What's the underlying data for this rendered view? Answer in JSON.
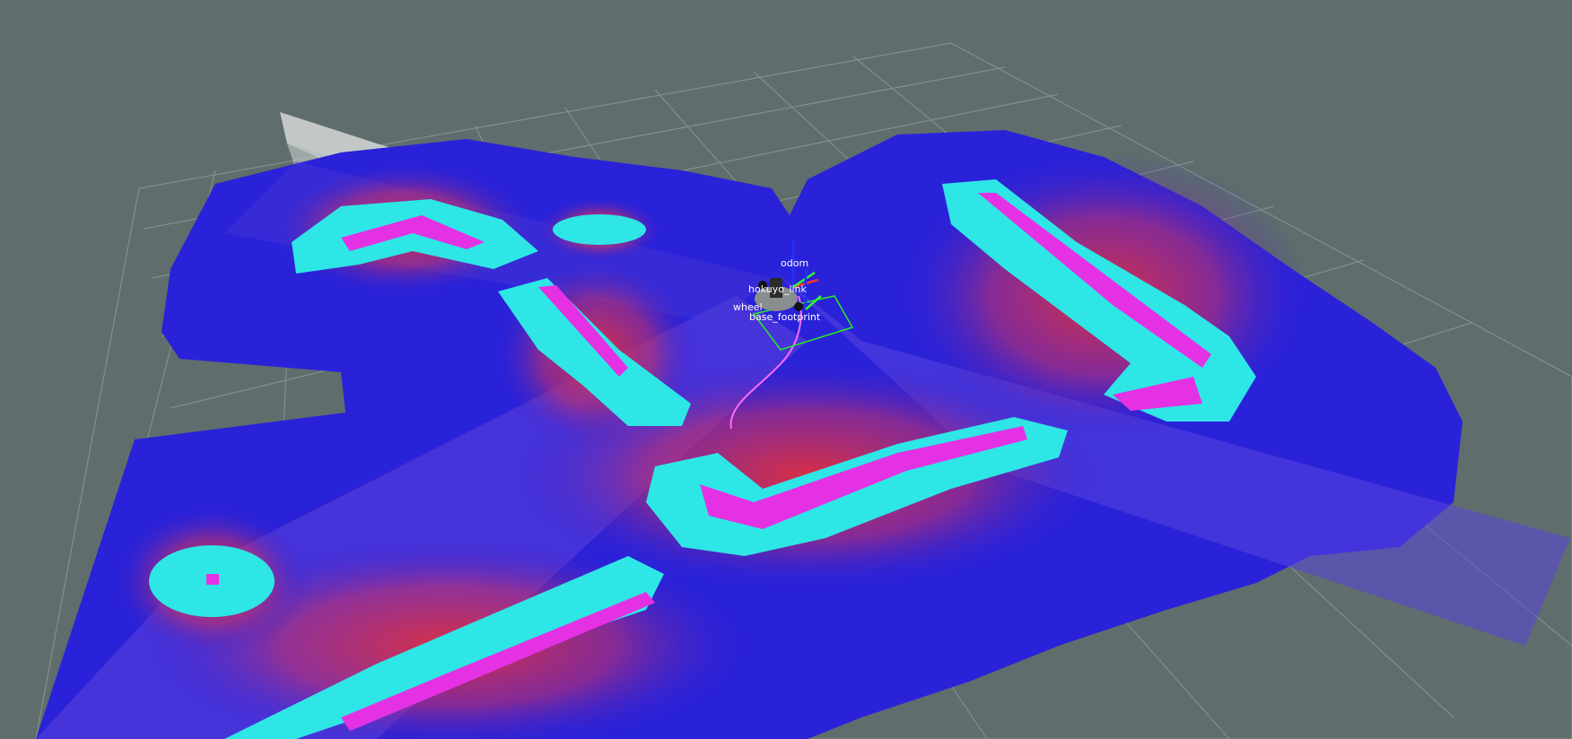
{
  "view": {
    "background": "#5f6e6c",
    "grid_color": "#a9b4b2",
    "costmap_colors": {
      "free": "#2a22d8",
      "gradient_mid": "#6a3ad8",
      "inflation": "#e0303c",
      "inscribed": "#2ee6e6",
      "lethal": "#e431e4",
      "unknown_laser": "#c8cccc"
    },
    "path_color": "#ff6bff",
    "footprint_color": "#22ee22"
  },
  "tf_frames": {
    "odom": "odom",
    "hokuyo": "hokuyo_link",
    "wheel": "wheel",
    "base": "base_footprint"
  },
  "icons": {
    "robot": "robot-model-icon",
    "axes": "tf-axes-icon"
  }
}
